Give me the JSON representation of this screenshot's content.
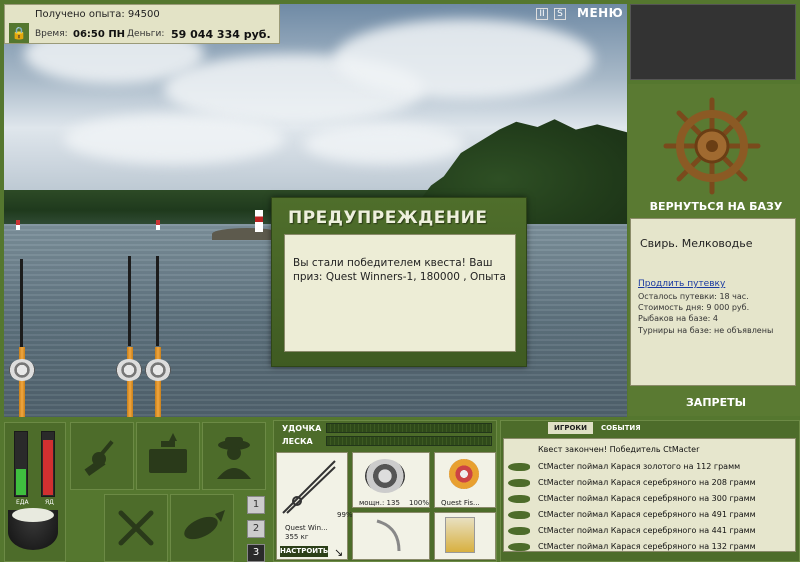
{
  "hud": {
    "experience": "Получено опыта: 94500",
    "time_label": "Время:",
    "time_value": "06:50 ПН",
    "money_label": "Деньги:",
    "money_value": "59 044 334 руб."
  },
  "topbar": {
    "pause_label": "II",
    "sound_label": "S",
    "menu_label": "МЕНЮ"
  },
  "sidebar": {
    "return_label": "ВЕРНУТЬСЯ НА БАЗУ",
    "location": "Свирь. Мелководье",
    "extend_link": "Продлить путевку",
    "permit_remaining": "Осталось путевки: 18 час.",
    "day_cost": "Стоимость дня: 9 000 руб.",
    "anglers": "Рыбаков на базе: 4",
    "tournaments": "Турниры на базе: не объявлены",
    "bans_label": "ЗАПРЕТЫ"
  },
  "dialog": {
    "title": "ПРЕДУПРЕЖДЕНИЕ",
    "message": "Вы стали победителем квеста! Ваш приз: Quest Winners-1, 180000 , Опыта"
  },
  "gauges": {
    "food_label": "ЕДА",
    "food_level": 0.42,
    "poison_label": "ЯД",
    "poison_level": 0.88,
    "food_color": "#3fbf3f",
    "poison_color": "#d03030"
  },
  "actions": {
    "page_numbers": [
      "1",
      "2",
      "3"
    ]
  },
  "tackle": {
    "rod_label": "УДОЧКА",
    "line_label": "ЛЕСКА",
    "rod_name": "Quest Win...",
    "rod_weight": "355 кг",
    "rod_wear": "99%",
    "reel_info": "мощн.: 135",
    "reel_wear": "100%",
    "line_name": "Quest Fis...",
    "setup_button": "НАСТРОИТЬ"
  },
  "events": {
    "tab_players": "ИГРОКИ",
    "tab_events": "СОБЫТИЯ",
    "header": "Квест закончен! Победитель CtMacter",
    "items": [
      "CtMacter поймал Карася золотого на 112 грамм",
      "CtMacter поймал Карася серебряного на 208 грамм",
      "CtMacter поймал Карася серебряного на 300 грамм",
      "CtMacter поймал Карася серебряного на 491 грамм",
      "CtMacter поймал Карася серебряного на 441 грамм",
      "CtMacter поймал Карася серебряного на 132 грамм"
    ]
  }
}
